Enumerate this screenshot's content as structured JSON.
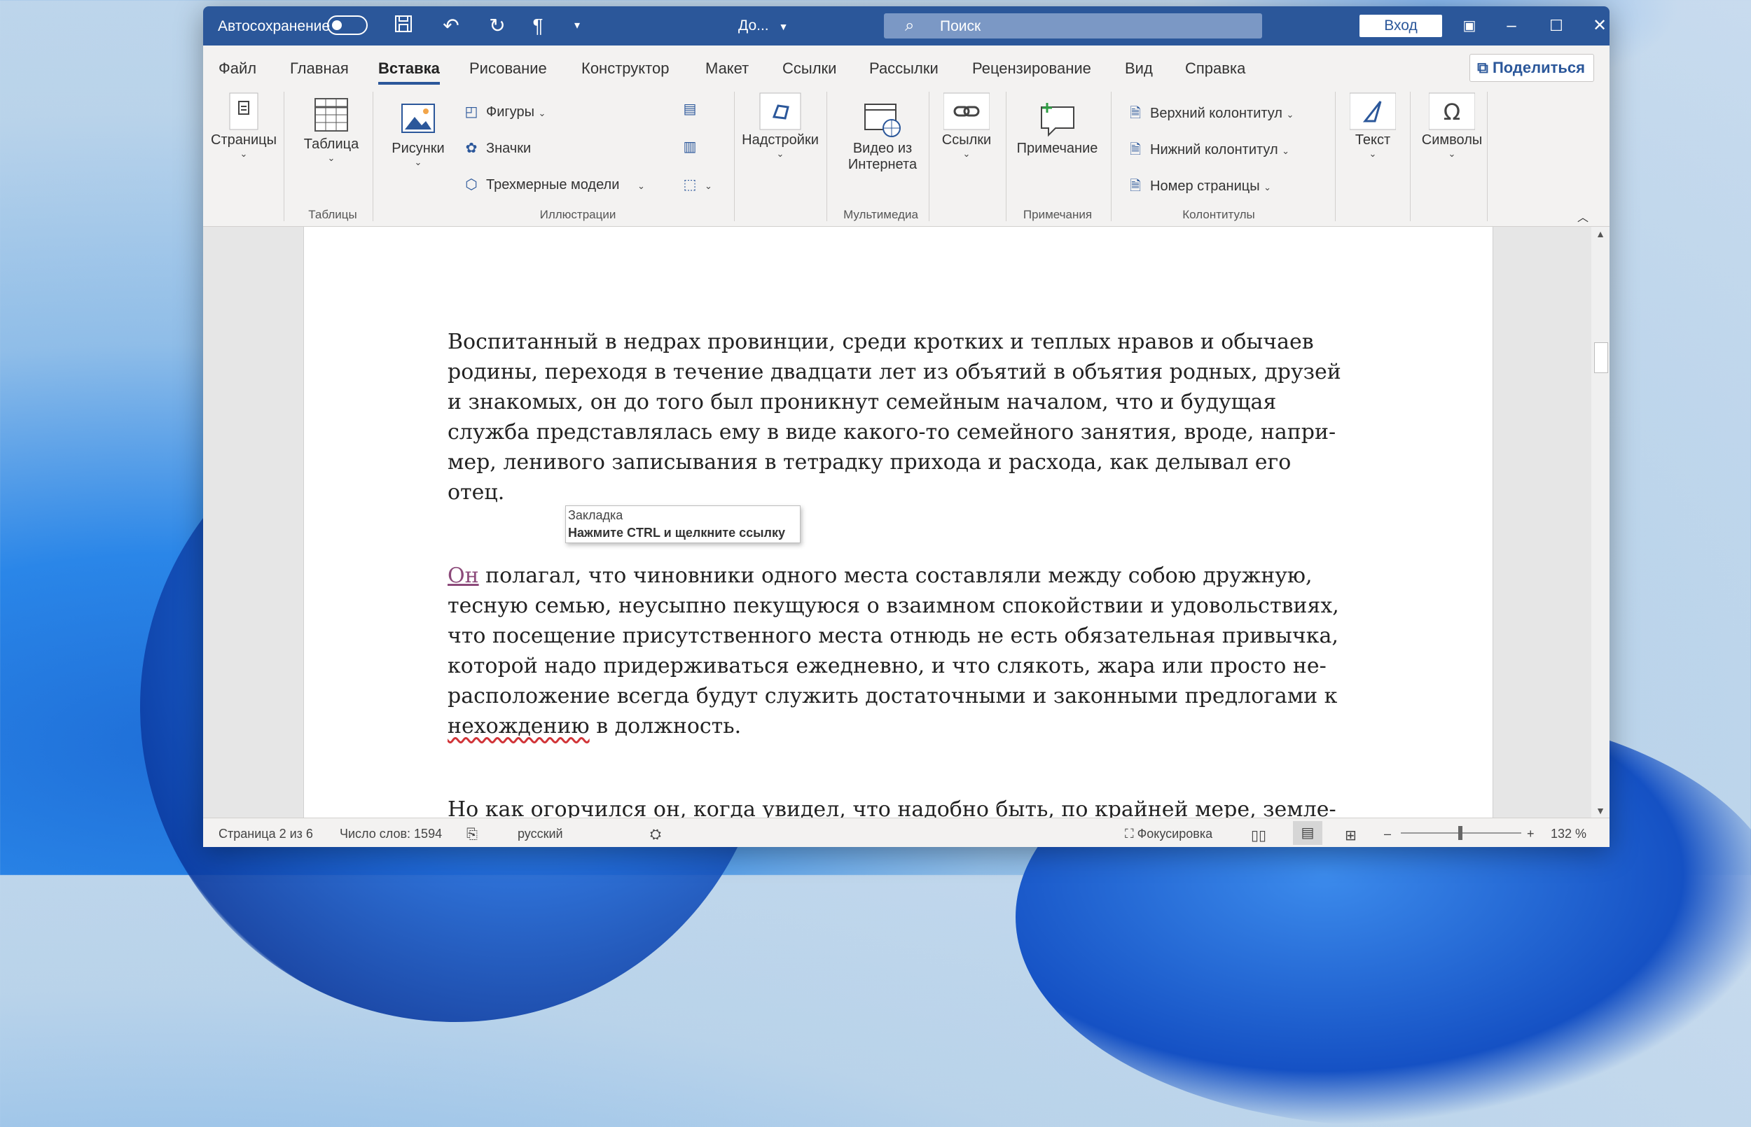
{
  "titlebar": {
    "autosave_label": "Автосохранение",
    "doc_title": "До...",
    "search_placeholder": "Поиск",
    "login_label": "Вход"
  },
  "menu": {
    "tabs": [
      "Файл",
      "Главная",
      "Вставка",
      "Рисование",
      "Конструктор",
      "Макет",
      "Ссылки",
      "Рассылки",
      "Рецензирование",
      "Вид",
      "Справка"
    ],
    "active_tab": "Вставка",
    "share_label": "Поделиться"
  },
  "ribbon": {
    "pages_label": "Страницы",
    "table_label": "Таблица",
    "group_tables": "Таблицы",
    "pictures_label": "Рисунки",
    "shapes_label": "Фигуры",
    "icons_label": "Значки",
    "models3d_label": "Трехмерные модели",
    "group_illustrations": "Иллюстрации",
    "addins_label": "Надстройки",
    "video_label_1": "Видео из",
    "video_label_2": "Интернета",
    "group_media": "Мультимедиа",
    "links_label": "Ссылки",
    "comment_label": "Примечание",
    "group_comments": "Примечания",
    "header_label": "Верхний колонтитул",
    "footer_label": "Нижний колонтитул",
    "pagenum_label": "Номер страницы",
    "group_headerfooter": "Колонтитулы",
    "text_label": "Текст",
    "symbols_label": "Символы"
  },
  "document": {
    "para1": [
      "Воспитанный в недрах провинции, среди кротких и теплых нравов и обычаев",
      "родины, переходя в течение двадцати лет из объятий в объятия родных, друзей",
      "и знакомых, он до того был проникнут семейным началом, что и будущая",
      "служба представлялась ему в виде какого-то семейного занятия, вроде, напри-",
      "мер, ленивого записывания в тетрадку прихода и расхода, как делывал его",
      "отец."
    ],
    "tooltip_title": "Закладка",
    "tooltip_hint": "Нажмите CTRL и щелкните ссылку",
    "para2_link": "Он",
    "para2_first_rest": " полагал, что чиновники одного места составляли между собою дружную,",
    "para2": [
      "тесную семью, неусыпно пекущуюся о взаимном спокойствии и удовольствиях,",
      "что посещение присутственного места отнюдь не есть обязательная привычка,",
      "которой надо придерживаться ежедневно, и что слякоть, жара или просто не-",
      "расположение всегда будут служить достаточными и законными предлогами к"
    ],
    "para2_last_squig": "нехождению",
    "para2_last_rest": " в должность.",
    "para3_first": "Но как огорчился он, когда увидел, что надобно быть, по крайней мере, земле-"
  },
  "status": {
    "page": "Страница 2 из 6",
    "words": "Число слов: 1594",
    "language": "русский",
    "focus": "Фокусировка",
    "zoom": "132 %"
  },
  "colors": {
    "title_bar": "#2b579a",
    "link": "#8c4a7a"
  }
}
